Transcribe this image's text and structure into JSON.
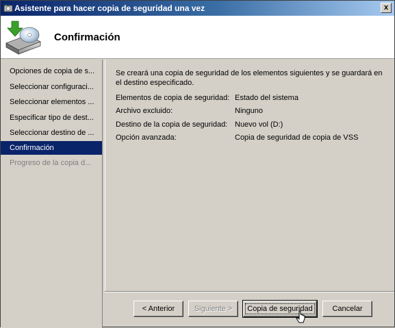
{
  "window": {
    "title": "Asistente para hacer copia de seguridad una vez",
    "close_label": "x"
  },
  "header": {
    "title": "Confirmación",
    "icon": "backup-wizard-icon"
  },
  "sidebar": {
    "items": [
      {
        "label": "Opciones de copia de s...",
        "state": "normal"
      },
      {
        "label": "Seleccionar configuraci...",
        "state": "normal"
      },
      {
        "label": "Seleccionar elementos ...",
        "state": "normal"
      },
      {
        "label": "Especificar tipo de dest...",
        "state": "normal"
      },
      {
        "label": "Seleccionar destino de ...",
        "state": "normal"
      },
      {
        "label": "Confirmación",
        "state": "active"
      },
      {
        "label": "Progreso de la copia d...",
        "state": "disabled"
      }
    ]
  },
  "main": {
    "intro": "Se creará una copia de seguridad de los elementos siguientes y se guardará en el destino especificado.",
    "rows": [
      {
        "label": "Elementos de copia de seguridad:",
        "value": "Estado del sistema"
      },
      {
        "label": "Archivo excluido:",
        "value": "Ninguno"
      },
      {
        "label": "Destino de la copia de seguridad:",
        "value": "Nuevo vol (D:)"
      },
      {
        "label": "Opción avanzada:",
        "value": "Copia de seguridad de copia de VSS"
      }
    ]
  },
  "buttons": {
    "back": "< Anterior",
    "next": "Siguiente >",
    "backup": "Copia de seguridad",
    "cancel": "Cancelar"
  },
  "colors": {
    "title_gradient_start": "#0a246a",
    "title_gradient_end": "#a6caf0",
    "selection": "#0a246a",
    "face": "#d4d0c8"
  }
}
